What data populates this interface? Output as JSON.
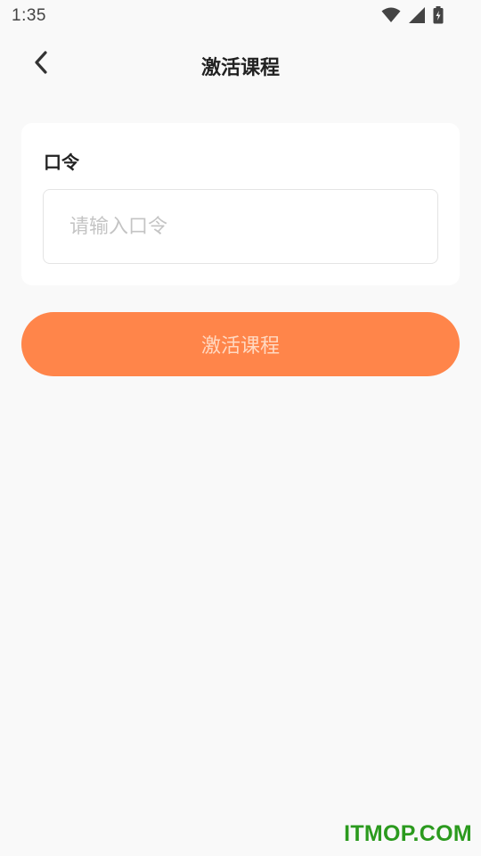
{
  "status_bar": {
    "time": "1:35",
    "icons": [
      "wifi-icon",
      "signal-icon",
      "battery-charging-icon"
    ]
  },
  "header": {
    "back_icon": "chevron-left-icon",
    "title": "激活课程"
  },
  "form": {
    "label": "口令",
    "input_value": "",
    "input_placeholder": "请输入口令"
  },
  "actions": {
    "activate_label": "激活课程"
  },
  "watermark": {
    "text": "ITMOP.COM"
  },
  "colors": {
    "background": "#f9f9f9",
    "accent": "#ff854a",
    "button_text": "#ffd9c2",
    "watermark": "#2b9a1e"
  }
}
